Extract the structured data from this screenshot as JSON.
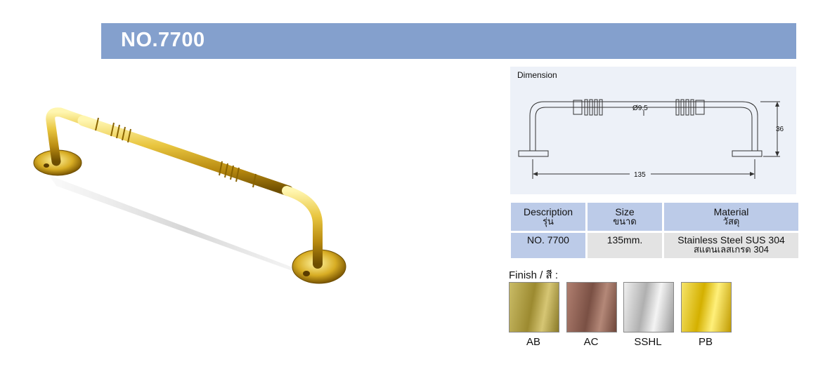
{
  "header": {
    "title": "NO.7700"
  },
  "dimension": {
    "label": "Dimension",
    "diameter": "Ø9.5",
    "height": "36",
    "length": "135"
  },
  "spec_table": {
    "headers": [
      {
        "en": "Description",
        "th": "รุ่น"
      },
      {
        "en": "Size",
        "th": "ขนาด"
      },
      {
        "en": "Material",
        "th": "วัสดุ"
      }
    ],
    "row": {
      "description": "NO. 7700",
      "size": "135mm.",
      "material_en": "Stainless Steel SUS 304",
      "material_th": "สแตนเลสเกรด 304"
    }
  },
  "finish": {
    "title": "Finish / สี :",
    "options": [
      {
        "code": "AB",
        "color": "#b8a84c"
      },
      {
        "code": "AC",
        "color": "#9a6a5a"
      },
      {
        "code": "SSHL",
        "color": "#d8d8d8"
      },
      {
        "code": "PB",
        "color": "#e8cc22"
      }
    ]
  },
  "colors": {
    "header_bg": "#84a0cd",
    "table_header_bg": "#bccbe8",
    "table_cell_bg": "#e3e3e3",
    "gold": "#d4a820"
  }
}
